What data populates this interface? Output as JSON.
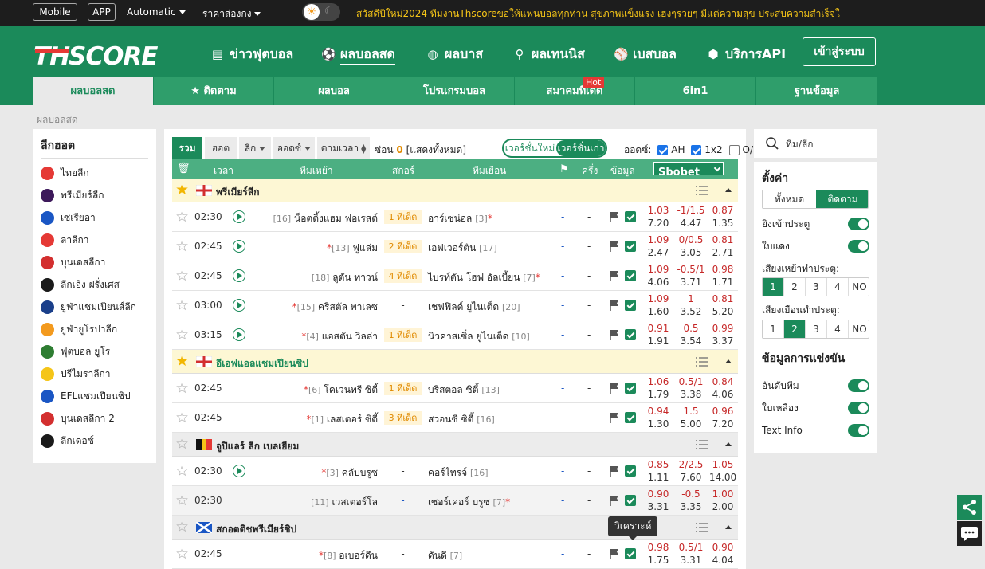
{
  "topbar": {
    "mobile": "Mobile",
    "app": "APP",
    "automatic": "Automatic",
    "price": "ราคาส่องกง",
    "announcement": "สวัสดีปีใหม่2024 ทีมงานThscoreขอให้แฟนบอลทุกท่าน สุขภาพแข็งแรง เฮงๆรวยๆ มีแต่ความสุข ประสบความสำเร็จใ"
  },
  "header": {
    "logo": "THSCORE",
    "nav": [
      "ข่าวฟุตบอล",
      "ผลบอลสด",
      "ผลบาส",
      "ผลเทนนิส",
      "เบสบอล",
      "บริการAPI"
    ],
    "login": "เข้าสู่ระบบ"
  },
  "subtabs": [
    "ผลบอลสด",
    "ติดตาม",
    "ผลบอล",
    "โปรแกรมบอล",
    "สมาคมที่เด็ด",
    "6in1",
    "ฐานข้อมูล"
  ],
  "hot_badge": "Hot",
  "breadcrumb": "ผลบอลสด",
  "left": {
    "title": "ลีกฮอต",
    "leagues": [
      "ไทยลีก",
      "พรีเมียร์ลีก",
      "เซเรียอา",
      "ลาลีกา",
      "บุนเดสลีกา",
      "ลีกเอิง ฝรั่งเศส",
      "ยูฟ่าแชมเปียนส์ลีก",
      "ยูฟ่ายูโรปาลีก",
      "ฟุตบอล ยูโร",
      "ปรีไมราลีกา",
      "EFLแชมเปียนชิป",
      "บุนเดสลีกา 2",
      "ลีกเดอซ์"
    ]
  },
  "filters": {
    "all": "รวม",
    "hot": "ฮอต",
    "league": "ลีก",
    "odds": "ออดซ์",
    "bytime": "ตามเวลา",
    "hidden_prefix": "ซ่อน",
    "hidden_count": "0",
    "show_all": "[แสดงทั้งหมด]",
    "ver_new": "เวอร์ชั่นใหม่",
    "ver_old": "เวอร์ชั่นเก่า",
    "odds_label": "ออดซ์:",
    "ah": "AH",
    "x12": "1x2",
    "ou": "O/U"
  },
  "columns": {
    "time": "เวลา",
    "home": "ทีมเหย้า",
    "score": "สกอร์",
    "away": "ทีมเยือน",
    "half": "ครึ่ง",
    "info": "ข้อมูล",
    "bookmaker": "Sbobet"
  },
  "groups": [
    {
      "name": "พรีเมียร์ลีก",
      "fav": true,
      "matches": [
        {
          "time": "02:30",
          "play": true,
          "home_rank": "[16]",
          "home": "น็อตติ้งแฮม ฟอเรสต์",
          "home_red": "",
          "score": "1 ทีเด็ด",
          "away": "อาร์เซน่อล",
          "away_rank": "[3]",
          "away_red": "*",
          "d1": "-",
          "d2": "-",
          "o1": "1.03",
          "o2": "-1/1.5",
          "o3": "0.87",
          "o4": "7.20",
          "o5": "4.47",
          "o6": "1.35"
        },
        {
          "time": "02:45",
          "play": true,
          "home_rank": "[13]",
          "home": "ฟูแล่ม",
          "home_red": "*",
          "score": "2 ทีเด็ด",
          "away": "เอฟเวอร์ตัน",
          "away_rank": "[17]",
          "away_red": "",
          "d1": "-",
          "d2": "-",
          "o1": "1.09",
          "o2": "0/0.5",
          "o3": "0.81",
          "o4": "2.47",
          "o5": "3.05",
          "o6": "2.71"
        },
        {
          "time": "02:45",
          "play": true,
          "home_rank": "[18]",
          "home": "ลูตัน ทาวน์",
          "home_red": "",
          "score": "4 ทีเด็ด",
          "away": "ไบรท์ตัน โฮฟ อัลเบี้ยน",
          "away_rank": "[7]",
          "away_red": "*",
          "d1": "-",
          "d2": "-",
          "o1": "1.09",
          "o2": "-0.5/1",
          "o3": "0.98",
          "o4": "4.06",
          "o5": "3.71",
          "o6": "1.71"
        },
        {
          "time": "03:00",
          "play": true,
          "home_rank": "[15]",
          "home": "คริสตัล พาเลซ",
          "home_red": "*",
          "score": "-",
          "away": "เชฟฟิลด์ ยูไนเต็ด",
          "away_rank": "[20]",
          "away_red": "",
          "d1": "-",
          "d2": "-",
          "o1": "1.09",
          "o2": "1",
          "o3": "0.81",
          "o4": "1.60",
          "o5": "3.52",
          "o6": "5.20"
        },
        {
          "time": "03:15",
          "play": true,
          "home_rank": "[4]",
          "home": "แอสตัน วิลล่า",
          "home_red": "*",
          "score": "1 ทีเด็ด",
          "away": "นิวคาสเซิ่ล ยูไนเต็ด",
          "away_rank": "[10]",
          "away_red": "",
          "d1": "-",
          "d2": "-",
          "o1": "0.91",
          "o2": "0.5",
          "o3": "0.99",
          "o4": "1.91",
          "o5": "3.54",
          "o6": "3.37"
        }
      ]
    },
    {
      "name": "อีเอฟแอลแชมเปียนชิป",
      "fav": true,
      "matches": [
        {
          "time": "02:45",
          "play": false,
          "home_rank": "[6]",
          "home": "โคเวนทรี ซิตี้",
          "home_red": "*",
          "score": "1 ทีเด็ด",
          "away": "บริสตอล ซิตี้",
          "away_rank": "[13]",
          "away_red": "",
          "d1": "-",
          "d2": "-",
          "o1": "1.06",
          "o2": "0.5/1",
          "o3": "0.84",
          "o4": "1.79",
          "o5": "3.38",
          "o6": "4.06"
        },
        {
          "time": "02:45",
          "play": false,
          "home_rank": "[1]",
          "home": "เลสเตอร์ ซิตี้",
          "home_red": "*",
          "score": "3 ทีเด็ด",
          "away": "สวอนซี ซิตี้",
          "away_rank": "[16]",
          "away_red": "",
          "d1": "-",
          "d2": "-",
          "o1": "0.94",
          "o2": "1.5",
          "o3": "0.96",
          "o4": "1.30",
          "o5": "5.00",
          "o6": "7.20"
        }
      ]
    },
    {
      "name": "จูปิแลร์ ลีก เบลเยียม",
      "fav": false,
      "matches": [
        {
          "time": "02:30",
          "play": true,
          "home_rank": "[3]",
          "home": "คลับบรูซ",
          "home_red": "*",
          "score": "-",
          "away": "คอร์ไทรจ์",
          "away_rank": "[16]",
          "away_red": "",
          "d1": "-",
          "d2": "-",
          "o1": "0.85",
          "o2": "2/2.5",
          "o3": "1.05",
          "o4": "1.11",
          "o5": "7.60",
          "o6": "14.00"
        },
        {
          "time": "02:30",
          "play": false,
          "home_rank": "[11]",
          "home": "เวสเตอร์โล",
          "home_red": "",
          "score": "-",
          "away": "เซอร์เคอร์ บรูซ",
          "away_rank": "[7]",
          "away_red": "*",
          "d1": "-",
          "d2": "-",
          "o1": "0.90",
          "o2": "-0.5",
          "o3": "1.00",
          "o4": "3.31",
          "o5": "3.35",
          "o6": "2.00"
        }
      ]
    },
    {
      "name": "สกอตติชพรีเมียร์ชิป",
      "fav": false,
      "matches": [
        {
          "time": "02:45",
          "play": false,
          "home_rank": "[8]",
          "home": "อเบอร์ดีน",
          "home_red": "*",
          "score": "-",
          "away": "ดันดี",
          "away_rank": "[7]",
          "away_red": "",
          "d1": "-",
          "d2": "-",
          "o1": "0.98",
          "o2": "0.5/1",
          "o3": "0.90",
          "o4": "1.75",
          "o5": "3.31",
          "o6": "4.04"
        }
      ]
    }
  ],
  "tooltip": "วิเคราะห์",
  "right": {
    "search_placeholder": "ทีม/ลีก",
    "settings_title": "ตั้งค่า",
    "seg_all": "ทั้งหมด",
    "seg_follow": "ติดตาม",
    "goal": "ยิงเข้าประตู",
    "redcard": "ใบแดง",
    "home_goal_sound": "เสียงเหย้าทำประตู:",
    "away_goal_sound": "เสียงเยือนทำประตู:",
    "sound_opts": [
      "1",
      "2",
      "3",
      "4",
      "NO"
    ],
    "match_info_title": "ข้อมูลการแข่งขัน",
    "ranking": "อันดับทีม",
    "yellow": "ใบเหลือง",
    "textinfo": "Text Info"
  },
  "colors": {
    "brand": "#1b8a5a",
    "accent": "#f5c518"
  }
}
